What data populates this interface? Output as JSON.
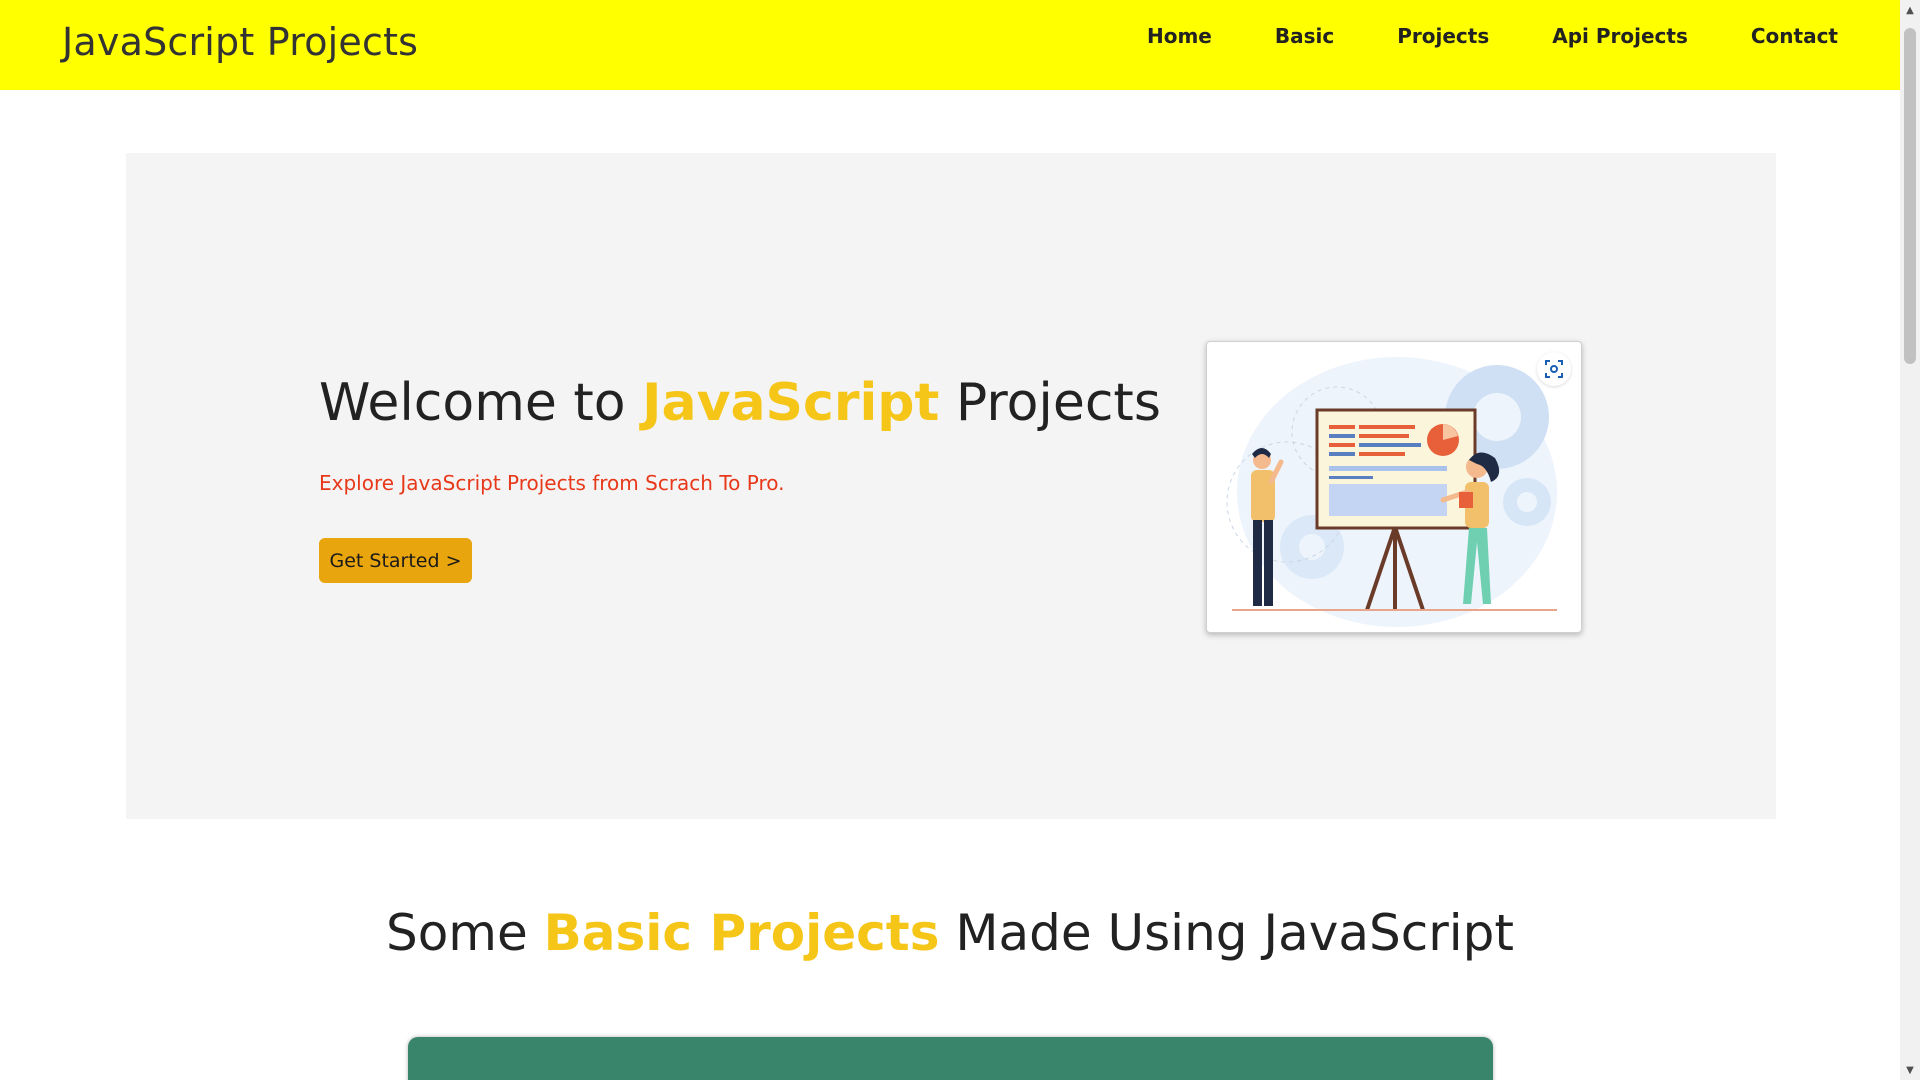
{
  "header": {
    "brand": "JavaScript Projects",
    "nav": [
      "Home",
      "Basic",
      "Projects",
      "Api Projects",
      "Contact"
    ]
  },
  "hero": {
    "title_before": "Welcome to ",
    "title_highlight": "JavaScript",
    "title_after": " Projects",
    "subtitle": "Explore JavaScript Projects from Scrach To Pro.",
    "button_label": "Get Started >"
  },
  "section": {
    "title_before": "Some ",
    "title_highlight": "Basic Projects",
    "title_after": " Made Using JavaScript"
  },
  "icons": {
    "lens": "visual-search-icon",
    "scroll_up": "scroll-up-arrow-icon",
    "scroll_down": "scroll-down-arrow-icon"
  },
  "colors": {
    "header_bg": "#ffff00",
    "highlight": "#f5c518",
    "subtitle": "#e8381a",
    "button": "#e8a50d",
    "card": "#38856b",
    "hero_bg": "#f4f4f4"
  }
}
